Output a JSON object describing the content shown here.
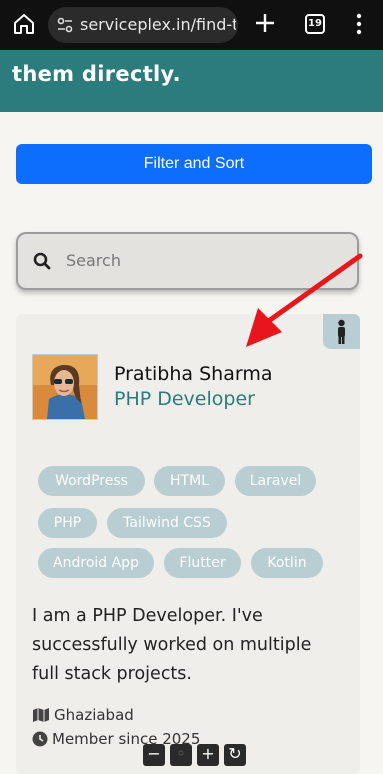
{
  "browser": {
    "url": "serviceplex.in/find-ta",
    "tab_count": "19"
  },
  "hero": {
    "text": "them directly."
  },
  "filter_button": {
    "label": "Filter and Sort"
  },
  "search": {
    "placeholder": "Search"
  },
  "profile": {
    "name": "Pratibha Sharma",
    "role": "PHP Developer",
    "skills": [
      "WordPress",
      "HTML",
      "Laravel",
      "PHP",
      "Tailwind CSS",
      "Android App",
      "Flutter",
      "Kotlin"
    ],
    "bio": "I am a PHP Developer. I've successfully worked on multiple full stack projects.",
    "location": "Ghaziabad",
    "member_since": "Member since 2025"
  },
  "colors": {
    "accent": "#2c7c7d",
    "button": "#0d6efd",
    "tag": "#b8ced3",
    "annotation_arrow": "#e8161b"
  },
  "icons": [
    "home-icon",
    "site-settings-icon",
    "plus-icon",
    "tabs-icon",
    "menu-icon",
    "search-icon",
    "person-icon",
    "map-icon",
    "clock-icon"
  ]
}
